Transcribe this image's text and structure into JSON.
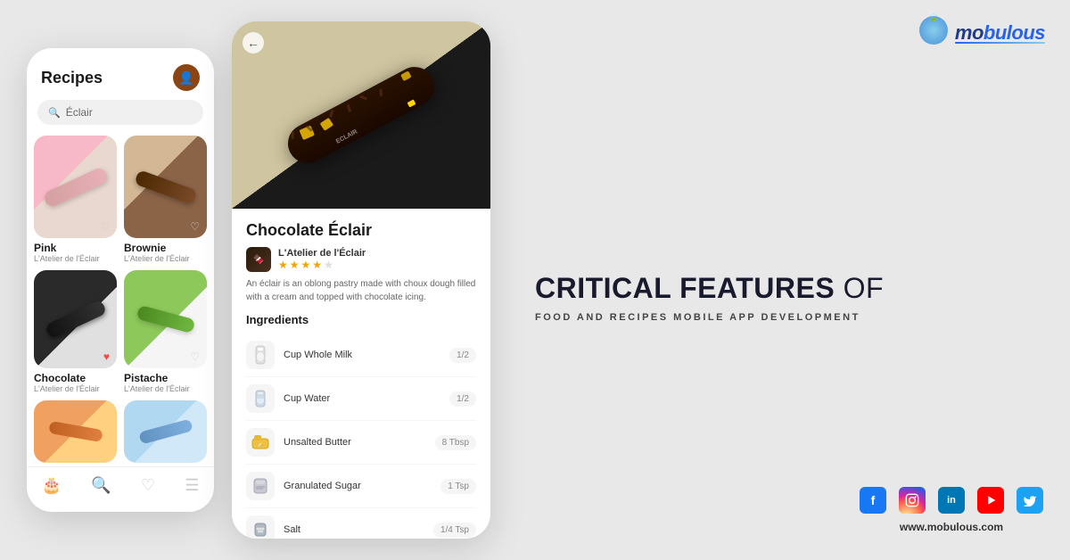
{
  "brand": {
    "name": "mobulous",
    "website": "www.mobulous.com",
    "logo_leaf": "🍃"
  },
  "features": {
    "heading_bold": "CRITICAL FEATURES",
    "heading_light": "OF",
    "subheading": "FOOD AND RECIPES MOBILE APP DEVELOPMENT"
  },
  "phone1": {
    "title": "Recipes",
    "search_placeholder": "Éclair",
    "recipes": [
      {
        "name": "Pink",
        "author": "L'Atelier de l'Éclair",
        "liked": false,
        "style": "pink"
      },
      {
        "name": "Brownie",
        "author": "L'Atelier de l'Éclair",
        "liked": false,
        "style": "brownie"
      },
      {
        "name": "Chocolate",
        "author": "L'Atelier de l'Éclair",
        "liked": true,
        "style": "chocolate"
      },
      {
        "name": "Pistache",
        "author": "L'Atelier de l'Éclair",
        "liked": false,
        "style": "pistachio"
      }
    ],
    "nav_items": [
      "🍰",
      "🔍",
      "❤️",
      "☰"
    ]
  },
  "phone2": {
    "title": "Chocolate Éclair",
    "chef": "L'Atelier de l'Éclair",
    "rating": 4,
    "max_rating": 5,
    "description": "An éclair is an oblong pastry made with choux dough filled with a cream and topped with chocolate icing.",
    "ingredients_label": "Ingredients",
    "ingredients": [
      {
        "name": "Cup Whole Milk",
        "amount": "1/2",
        "icon": "🥛"
      },
      {
        "name": "Cup Water",
        "amount": "1/2",
        "icon": "💧"
      },
      {
        "name": "Unsalted Butter",
        "amount": "8 Tbsp",
        "icon": "🧈"
      },
      {
        "name": "Granulated Sugar",
        "amount": "1 Tsp",
        "icon": "🧂"
      },
      {
        "name": "Salt",
        "amount": "1/4 Tsp",
        "icon": "🧂"
      }
    ]
  },
  "social": {
    "icons": [
      "f",
      "ig",
      "in",
      "▶",
      "🐦"
    ],
    "labels": [
      "facebook",
      "instagram",
      "linkedin",
      "youtube",
      "twitter"
    ]
  }
}
